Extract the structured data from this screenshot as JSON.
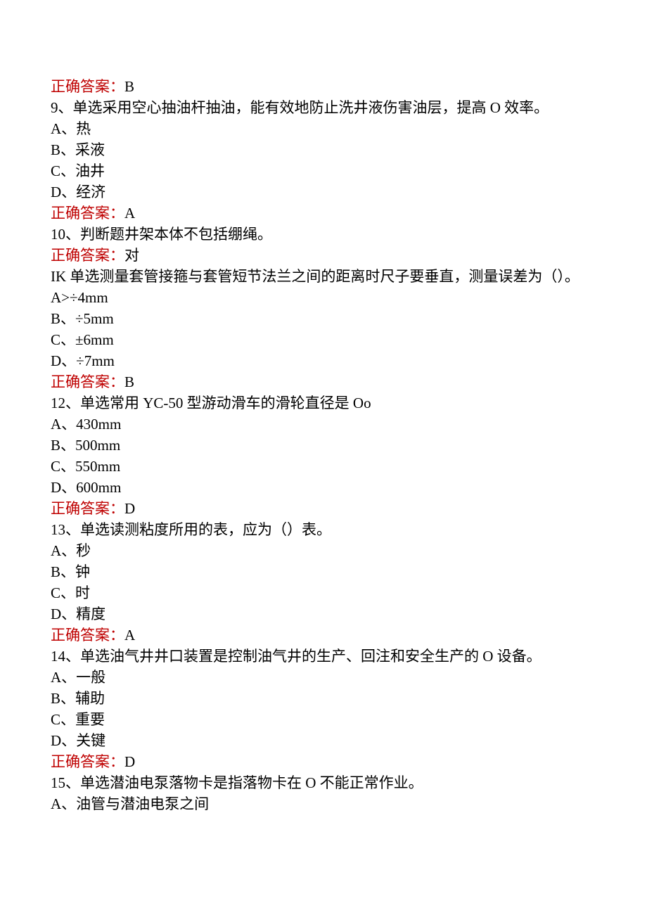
{
  "labels": {
    "correct_answer": "正确答案："
  },
  "items": [
    {
      "kind": "answer",
      "value": "B"
    },
    {
      "kind": "question",
      "name": "question-9",
      "text": "9、单选采用空心抽油杆抽油，能有效地防止洗井液伤害油层，提高 O 效率。",
      "options": [
        {
          "name": "q9-option-a",
          "text": "A、热"
        },
        {
          "name": "q9-option-b",
          "text": "B、采液"
        },
        {
          "name": "q9-option-c",
          "text": "C、油井"
        },
        {
          "name": "q9-option-d",
          "text": "D、经济"
        }
      ],
      "answer": "A"
    },
    {
      "kind": "question",
      "name": "question-10",
      "text": "10、判断题井架本体不包括绷绳。",
      "options": [],
      "answer": "对"
    },
    {
      "kind": "question",
      "name": "question-11",
      "text": "IK 单选测量套管接箍与套管短节法兰之间的距离时尺子要垂直，测量误差为（）。",
      "options": [
        {
          "name": "q11-option-a",
          "text": "A>÷4mm"
        },
        {
          "name": "q11-option-b",
          "text": "B、÷5mm"
        },
        {
          "name": "q11-option-c",
          "text": "C、±6mm"
        },
        {
          "name": "q11-option-d",
          "text": "D、÷7mm"
        }
      ],
      "answer": "B"
    },
    {
      "kind": "question",
      "name": "question-12",
      "text": "12、单选常用 YC-50 型游动滑车的滑轮直径是 Oo",
      "options": [
        {
          "name": "q12-option-a",
          "text": "A、430mm"
        },
        {
          "name": "q12-option-b",
          "text": "B、500mm"
        },
        {
          "name": "q12-option-c",
          "text": "C、550mm"
        },
        {
          "name": "q12-option-d",
          "text": "D、600mm"
        }
      ],
      "answer": "D"
    },
    {
      "kind": "question",
      "name": "question-13",
      "text": "13、单选读测粘度所用的表，应为（）表。",
      "options": [
        {
          "name": "q13-option-a",
          "text": "A、秒"
        },
        {
          "name": "q13-option-b",
          "text": "B、钟"
        },
        {
          "name": "q13-option-c",
          "text": "C、时"
        },
        {
          "name": "q13-option-d",
          "text": "D、精度"
        }
      ],
      "answer": "A"
    },
    {
      "kind": "question",
      "name": "question-14",
      "text": "14、单选油气井井口装置是控制油气井的生产、回注和安全生产的 O 设备。",
      "options": [
        {
          "name": "q14-option-a",
          "text": "A、一般"
        },
        {
          "name": "q14-option-b",
          "text": "B、辅助"
        },
        {
          "name": "q14-option-c",
          "text": "C、重要"
        },
        {
          "name": "q14-option-d",
          "text": "D、关键"
        }
      ],
      "answer": "D"
    },
    {
      "kind": "question",
      "name": "question-15",
      "text": "15、单选潜油电泵落物卡是指落物卡在 O 不能正常作业。",
      "options": [
        {
          "name": "q15-option-a",
          "text": "A、油管与潜油电泵之间"
        }
      ]
    }
  ]
}
